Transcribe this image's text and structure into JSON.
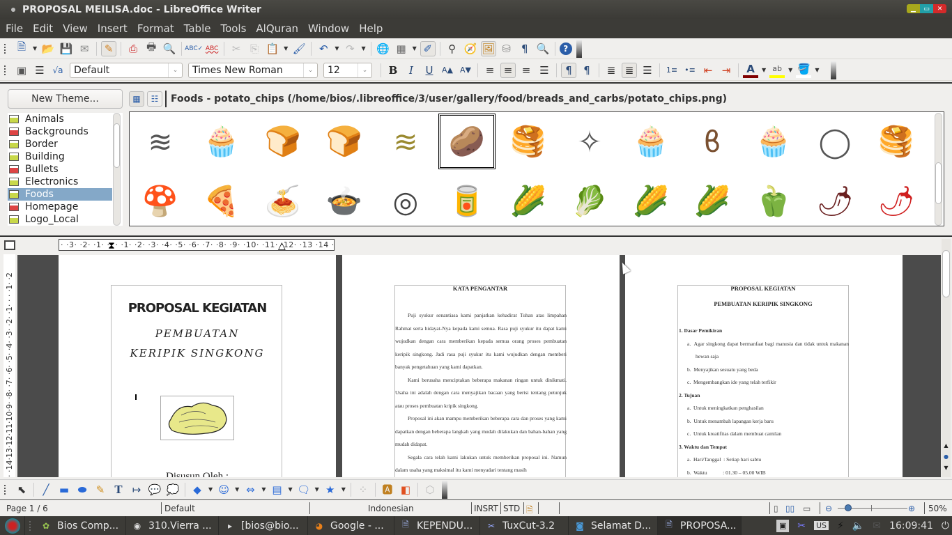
{
  "window": {
    "title": "PROPOSAL MEILISA.doc - LibreOffice Writer",
    "controls": [
      "minimize",
      "maximize",
      "close"
    ]
  },
  "menu": [
    "File",
    "Edit",
    "View",
    "Insert",
    "Format",
    "Table",
    "Tools",
    "AlQuran",
    "Window",
    "Help"
  ],
  "standard_toolbar": {
    "icons": [
      "new-icon",
      "open-icon",
      "save-icon",
      "email-icon",
      "edit-mode-icon",
      "export-pdf-icon",
      "print-icon",
      "print-preview-icon",
      "spellcheck-icon",
      "autospellcheck-icon",
      "cut-icon",
      "copy-icon",
      "paste-icon",
      "clone-format-icon",
      "undo-icon",
      "redo-icon",
      "hyperlink-icon",
      "table-icon",
      "show-draw-functions-icon",
      "find-replace-icon",
      "navigator-icon",
      "gallery-icon",
      "data-sources-icon",
      "formatting-marks-icon",
      "zoom-icon",
      "help-icon"
    ]
  },
  "formatting_toolbar": {
    "paragraph_style": "Default",
    "font_name": "Times New Roman",
    "font_size": "12",
    "bold": "B",
    "italic": "I",
    "underline": "U",
    "alignment_active": "center",
    "font_color": "#800000",
    "highlight_color": "#ffff00"
  },
  "gallery": {
    "new_theme_label": "New Theme...",
    "themes": [
      {
        "label": "Animals",
        "color": "green"
      },
      {
        "label": "Backgrounds",
        "color": "red"
      },
      {
        "label": "Border",
        "color": "green"
      },
      {
        "label": "Building",
        "color": "green"
      },
      {
        "label": "Bullets",
        "color": "red"
      },
      {
        "label": "Electronics",
        "color": "green"
      },
      {
        "label": "Foods",
        "color": "green",
        "selected": true
      },
      {
        "label": "Homepage",
        "color": "red"
      },
      {
        "label": "Logo_Local",
        "color": "green"
      }
    ],
    "path_label": "Foods - potato_chips (/home/bios/.libreoffice/3/user/gallery/food/breads_and_carbs/potato_chips.png)",
    "items_row1": [
      "shredded-cheese",
      "muffin-brown",
      "bread-outline",
      "bread-yellow",
      "hash-browns",
      "potato-chips",
      "pancakes",
      "potato-chips-outline",
      "muffin-yellow",
      "pretzel",
      "muffin-outline",
      "donut-outline",
      "pancakes-outline"
    ],
    "items_row2": [
      "mushrooms",
      "pizza-slice",
      "spaghetti",
      "saucepan",
      "onion-rings",
      "food-group",
      "corn-cob",
      "cabbage",
      "corn-yellow",
      "corn-outline",
      "green-pepper",
      "chili-dark",
      "chili-red"
    ],
    "selected_item": "potato-chips"
  },
  "ruler": {
    "horizontal": "· ·3· ·2· ·1· ·  · ·1· ·2· ·3· ·4· ·5· ·6· ·7· ·8· ·9· ·10· ·11· ·12· ·13 ·14 ·15 ·16 · ·",
    "vertical": "· ·14·13·12·11·10·9· ·8· ·7· ·6· ·5· ·4· ·3· ·2· ·1· · · ·1· ·2"
  },
  "document": {
    "page1": {
      "title": "PROPOSAL KEGIATAN",
      "subtitle1": "PEMBUATAN",
      "subtitle2": "KERIPIK SINGKONG",
      "footer_partial": "Disusun Oleh :"
    },
    "page2": {
      "heading": "KATA PENGANTAR",
      "paragraphs": [
        "Puji syukur senantiasa kami panjatkan kehadirat Tuhan atas limpahan Rahmat serta hidayat-Nya kepada kami semua. Rasa puji syukur itu dapat kami wujudkan dengan cara memberikan kepada semua orang proses pembuatan keripik singkong. Jadi rasa puji syukur itu kami wujudkan dengan memberi banyak pengetahuan yang kami dapatkan.",
        "Kami berusaha menciptakan beberapa makanan ringan untuk dinikmati. Usaha ini adalah dengan cara menyajikan bacaan yang berisi tentang petunjuk atau proses pembuatan kripik singkong.",
        "Proposal ini akan mampu memberikan beberapa cara dan proses yang kami dapatkan dengan beberapa langkah yang mudah dilakukan dan bahan-bahan yang mudah didapat.",
        "Segala cara telah kami lakukan untuk memberikan proposal ini. Namun dalam usaha yang maksimal itu kami menyadari tentang masih"
      ]
    },
    "page3": {
      "heading1": "PROPOSAL KEGIATAN",
      "heading2": "PEMBUATAN KERIPIK SINGKONG",
      "sections": [
        {
          "num": "1.",
          "title": "Dasar Pemikiran",
          "items": [
            {
              "k": "a.",
              "t": "Agar singkong dapat bermanfaat bagi manusia dan tidak untuk makanan hewan saja"
            },
            {
              "k": "b.",
              "t": "Menyajikan sesuatu yang beda"
            },
            {
              "k": "c.",
              "t": "Mengembangkan ide yang telah terfikir"
            }
          ]
        },
        {
          "num": "2.",
          "title": "Tujuan",
          "items": [
            {
              "k": "a.",
              "t": "Untuk meningkatkan penghasilan"
            },
            {
              "k": "b.",
              "t": "Untuk menambah lapangan kerja baru"
            },
            {
              "k": "c.",
              "t": "Untuk kreatifitas dalam membuat camilan"
            }
          ]
        },
        {
          "num": "3.",
          "title": "Waktu dan Tempat",
          "items": [
            {
              "k": "a.",
              "t": "Hari/Tanggal  : Setiap hari sabtu"
            },
            {
              "k": "b.",
              "t": "Waktu            : 01.30 – 05.00 WIB"
            }
          ]
        }
      ]
    }
  },
  "status_bar": {
    "page": "Page 1 / 6",
    "style": "Default",
    "language": "Indonesian",
    "insert_mode": "INSRT",
    "selection_mode": "STD",
    "zoom": "50%",
    "zoom_fraction": 0.1
  },
  "taskbar": {
    "tasks": [
      {
        "label": "Bios Comp...",
        "icon": "app-icon"
      },
      {
        "label": "310.Vierra ...",
        "icon": "media-player-icon"
      },
      {
        "label": "[bios@bio...",
        "icon": "terminal-icon"
      },
      {
        "label": "Google - ...",
        "icon": "firefox-icon"
      },
      {
        "label": "KEPENDU...",
        "icon": "writer-doc-icon"
      },
      {
        "label": "TuxCut-3.2",
        "icon": "scissors-icon"
      },
      {
        "label": "Selamat D...",
        "icon": "browser-icon"
      },
      {
        "label": "PROPOSA...",
        "icon": "writer-doc-icon",
        "active": true
      }
    ],
    "tray": {
      "keyboard_layout": "US",
      "clock": "16:09:41"
    }
  }
}
